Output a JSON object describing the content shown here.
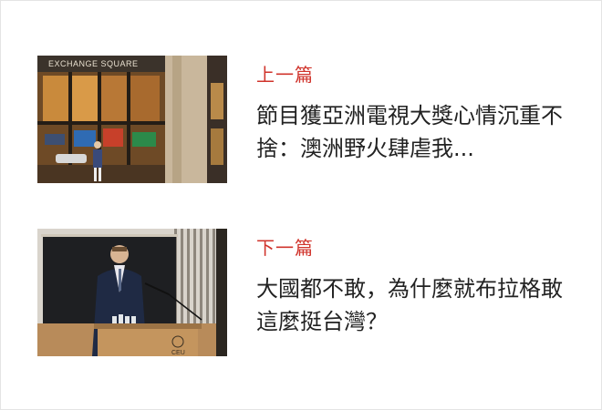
{
  "previous": {
    "label": "上一篇",
    "title": "節目獲亞洲電視大獎心情沉重不捨：澳洲野火肆虐我...",
    "image_sign_text": "EXCHANGE SQUARE"
  },
  "next": {
    "label": "下一篇",
    "title": "大國都不敢，為什麼就布拉格敢這麼挺台灣？",
    "image_podium_text": "CEU"
  }
}
